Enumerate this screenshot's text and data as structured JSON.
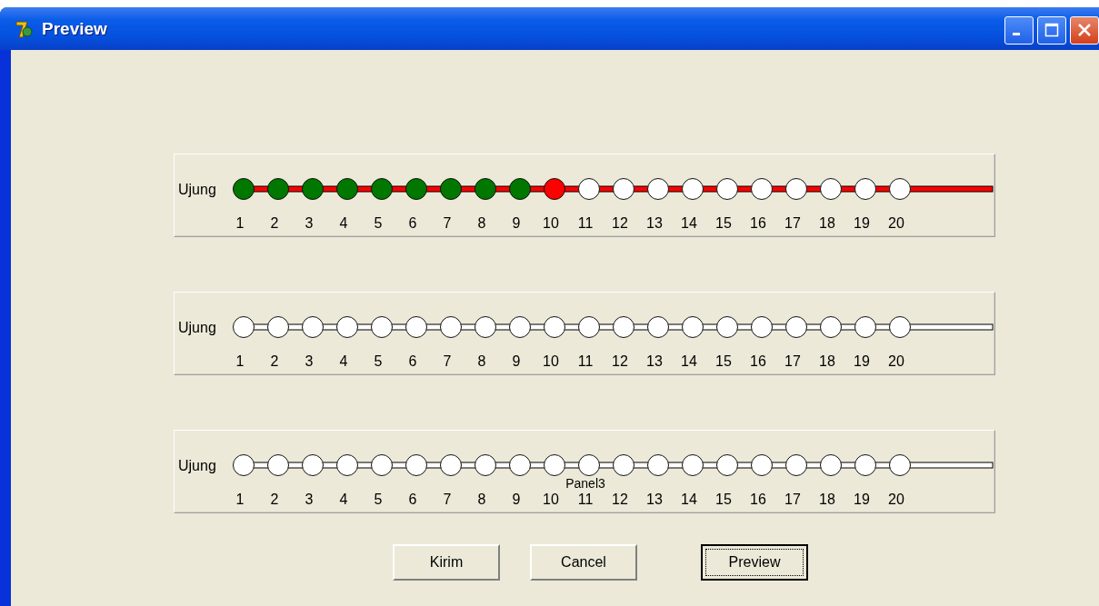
{
  "window": {
    "title": "Preview"
  },
  "panels": [
    {
      "label": "Ujung",
      "color": "#ff0000",
      "nodes": [
        {
          "number": "1",
          "color": "#007800"
        },
        {
          "number": "2",
          "color": "#007800"
        },
        {
          "number": "3",
          "color": "#007800"
        },
        {
          "number": "4",
          "color": "#007800"
        },
        {
          "number": "5",
          "color": "#007800"
        },
        {
          "number": "6",
          "color": "#007800"
        },
        {
          "number": "7",
          "color": "#007800"
        },
        {
          "number": "8",
          "color": "#007800"
        },
        {
          "number": "9",
          "color": "#007800"
        },
        {
          "number": "10",
          "color": "#ff0000"
        },
        {
          "number": "11",
          "color": "#ffffff"
        },
        {
          "number": "12",
          "color": "#ffffff"
        },
        {
          "number": "13",
          "color": "#ffffff"
        },
        {
          "number": "14",
          "color": "#ffffff"
        },
        {
          "number": "15",
          "color": "#ffffff"
        },
        {
          "number": "16",
          "color": "#ffffff"
        },
        {
          "number": "17",
          "color": "#ffffff"
        },
        {
          "number": "18",
          "color": "#ffffff"
        },
        {
          "number": "19",
          "color": "#ffffff"
        },
        {
          "number": "20",
          "color": "#ffffff"
        }
      ]
    },
    {
      "label": "Ujung",
      "color": "#ffffff",
      "nodes": [
        {
          "number": "1",
          "color": "#ffffff"
        },
        {
          "number": "2",
          "color": "#ffffff"
        },
        {
          "number": "3",
          "color": "#ffffff"
        },
        {
          "number": "4",
          "color": "#ffffff"
        },
        {
          "number": "5",
          "color": "#ffffff"
        },
        {
          "number": "6",
          "color": "#ffffff"
        },
        {
          "number": "7",
          "color": "#ffffff"
        },
        {
          "number": "8",
          "color": "#ffffff"
        },
        {
          "number": "9",
          "color": "#ffffff"
        },
        {
          "number": "10",
          "color": "#ffffff"
        },
        {
          "number": "11",
          "color": "#ffffff"
        },
        {
          "number": "12",
          "color": "#ffffff"
        },
        {
          "number": "13",
          "color": "#ffffff"
        },
        {
          "number": "14",
          "color": "#ffffff"
        },
        {
          "number": "15",
          "color": "#ffffff"
        },
        {
          "number": "16",
          "color": "#ffffff"
        },
        {
          "number": "17",
          "color": "#ffffff"
        },
        {
          "number": "18",
          "color": "#ffffff"
        },
        {
          "number": "19",
          "color": "#ffffff"
        },
        {
          "number": "20",
          "color": "#ffffff"
        }
      ]
    },
    {
      "label": "Ujung",
      "caption": "Panel3",
      "color": "#ffffff",
      "nodes": [
        {
          "number": "1",
          "color": "#ffffff"
        },
        {
          "number": "2",
          "color": "#ffffff"
        },
        {
          "number": "3",
          "color": "#ffffff"
        },
        {
          "number": "4",
          "color": "#ffffff"
        },
        {
          "number": "5",
          "color": "#ffffff"
        },
        {
          "number": "6",
          "color": "#ffffff"
        },
        {
          "number": "7",
          "color": "#ffffff"
        },
        {
          "number": "8",
          "color": "#ffffff"
        },
        {
          "number": "9",
          "color": "#ffffff"
        },
        {
          "number": "10",
          "color": "#ffffff"
        },
        {
          "number": "11",
          "color": "#ffffff"
        },
        {
          "number": "12",
          "color": "#ffffff"
        },
        {
          "number": "13",
          "color": "#ffffff"
        },
        {
          "number": "14",
          "color": "#ffffff"
        },
        {
          "number": "15",
          "color": "#ffffff"
        },
        {
          "number": "16",
          "color": "#ffffff"
        },
        {
          "number": "17",
          "color": "#ffffff"
        },
        {
          "number": "18",
          "color": "#ffffff"
        },
        {
          "number": "19",
          "color": "#ffffff"
        },
        {
          "number": "20",
          "color": "#ffffff"
        }
      ]
    }
  ],
  "buttons": [
    {
      "label": "Kirim",
      "focused": false
    },
    {
      "label": "Cancel",
      "focused": false
    },
    {
      "label": "Preview",
      "focused": true
    }
  ]
}
